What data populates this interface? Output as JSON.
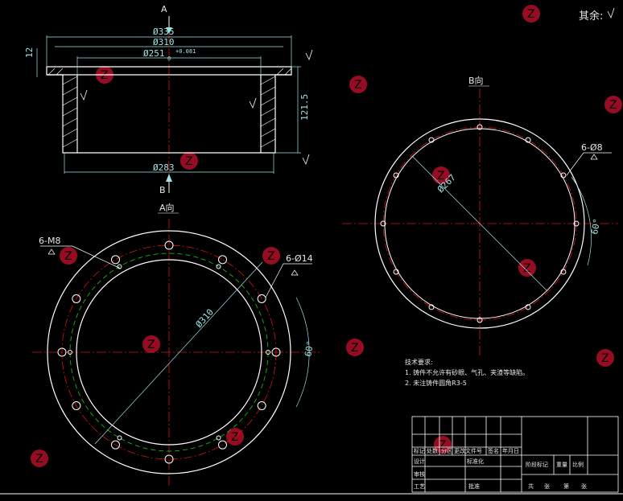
{
  "header": {
    "other_label": "其余:"
  },
  "section": {
    "view_a": "A",
    "view_b": "B",
    "dims": {
      "d335": "Ø335",
      "d310": "Ø310",
      "d251": "Ø251",
      "d251_tol": "+0.081",
      "d251_tol_low": "0",
      "d283": "Ø283",
      "h12": "12",
      "h1215": "121.5"
    }
  },
  "view_a": {
    "title": "A向",
    "callout_m8": "6-M8",
    "callout_d14": "6-Ø14",
    "dia": "Ø310",
    "angle": "60°"
  },
  "view_b": {
    "title": "B向",
    "callout_d8": "6-Ø8",
    "dia": "Ø267",
    "angle": "60°"
  },
  "notes": {
    "title": "技术要求:",
    "line1": "1. 铸件不允许有砂眼、气孔、夹渣等缺陷。",
    "line2": "2. 未注铸件圆角R3-5"
  },
  "title_block": {
    "biaoji": "标记",
    "chushu": "处数",
    "fenqu": "分区",
    "gengai": "更改文件号",
    "qianming": "签名",
    "nianyueri": "年月日",
    "sheji": "设计",
    "biaozhunhua": "标准化",
    "jieduan": "阶段标记",
    "zhongliang": "重量",
    "bili": "比例",
    "shenhe": "审核",
    "gongyi": "工艺",
    "pizhun": "批准",
    "gong": "共",
    "zhang": "张",
    "di": "第"
  },
  "colors": {
    "outline": "#ffffff",
    "center": "#d21414",
    "dim": "#9fe3e6",
    "hidden": "#14b414",
    "watermark": "#c8102e"
  }
}
